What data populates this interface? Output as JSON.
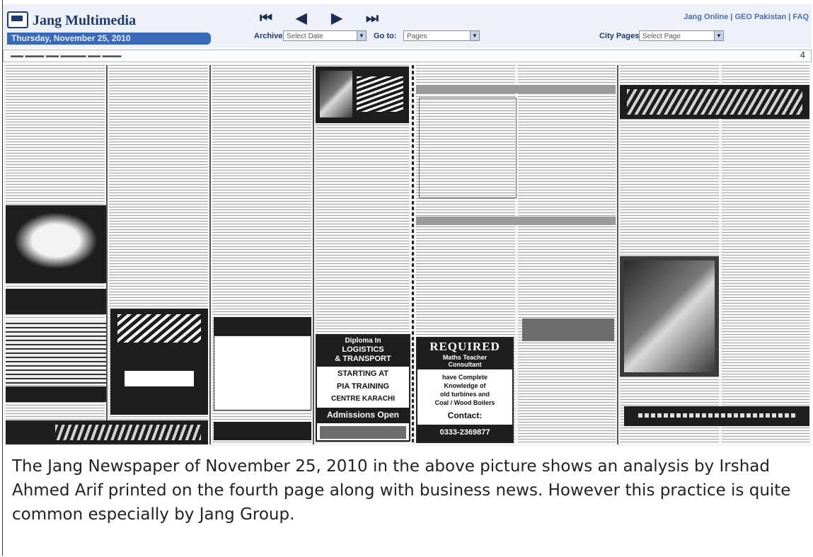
{
  "header": {
    "logo_text": "Jang Multimedia",
    "date_text": "Thursday, November 25, 2010",
    "nav_buttons": [
      "first-page",
      "previous-page",
      "next-page",
      "last-page"
    ],
    "archive_label": "Archive",
    "archive_select": "Select Date",
    "goto_label": "Go to:",
    "goto_select": "Pages",
    "city_pages_label": "City Pages",
    "city_pages_select": "Select Page",
    "top_links": "Jang Online | GEO Pakistan | FAQ"
  },
  "newspaper": {
    "ad_required_title": "REQUIRED",
    "ad_required_sub1": "Maths Teacher",
    "ad_required_sub2": "Consultant",
    "ad_required_body1": "have Complete",
    "ad_required_body2": "Knowledge of",
    "ad_required_body3": "old turbines and",
    "ad_required_body4": "Coal / Wood Boilers",
    "ad_required_contact": "Contact:",
    "ad_required_phone": "0333-2369877",
    "ad_transport_l1": "Diploma In",
    "ad_transport_l2": "LOGISTICS",
    "ad_transport_l3": "& TRANSPORT",
    "ad_transport_l4": "STARTING AT",
    "ad_transport_l5": "PIA TRAINING",
    "ad_transport_l6": "CENTRE KARACHI",
    "ad_transport_l7": "Admissions Open"
  },
  "caption": "The Jang Newspaper of November 25, 2010 in the above picture shows an analysis by Irshad Ahmed Arif printed on the fourth page along with business news. However this practice is quite common especially by Jang Group."
}
